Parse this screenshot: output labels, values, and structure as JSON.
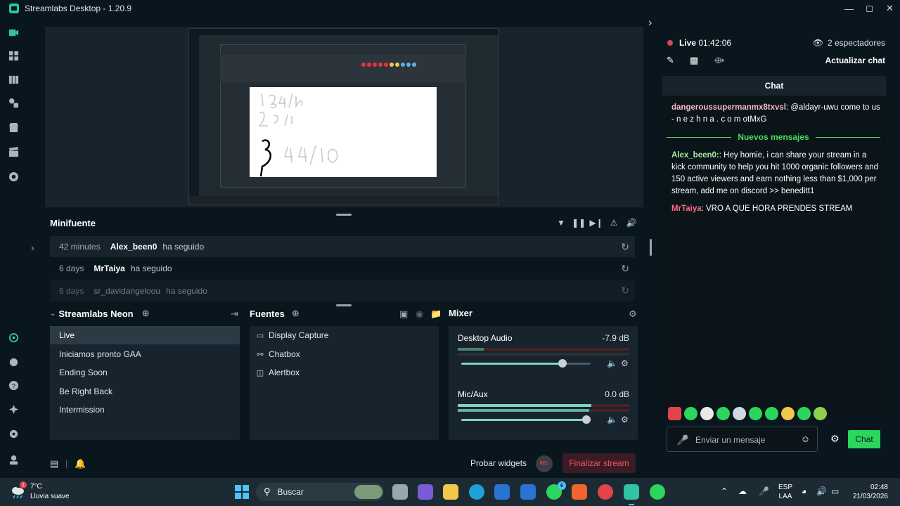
{
  "window": {
    "title": "Streamlabs Desktop - 1.20.9"
  },
  "minifuente": {
    "title": "Minifuente",
    "rows": [
      {
        "time": "42 minutes",
        "user": "Alex_been0",
        "action": "ha seguido"
      },
      {
        "time": "6 days",
        "user": "MrTaiya",
        "action": "ha seguido"
      },
      {
        "time": "6 days",
        "user": "sr_davidangeloou",
        "action": "ha seguido"
      }
    ]
  },
  "scenes": {
    "collection": "Streamlabs Neon",
    "items": [
      "Live",
      "Iniciamos pronto GAA",
      "Ending Soon",
      "Be Right Back",
      "Intermission"
    ],
    "active_index": 0
  },
  "sources": {
    "title": "Fuentes",
    "items": [
      {
        "label": "Display Capture",
        "icon": "monitor-icon"
      },
      {
        "label": "Chatbox",
        "icon": "chat-bubbles-icon"
      },
      {
        "label": "Alertbox",
        "icon": "alertbox-icon"
      }
    ]
  },
  "mixer": {
    "title": "Mixer",
    "channels": [
      {
        "name": "Desktop Audio",
        "db": "-7.9 dB",
        "level": 0.78,
        "meter": 0.15
      },
      {
        "name": "Mic/Aux",
        "db": "0.0 dB",
        "level": 1.0,
        "meter": 0.78
      }
    ]
  },
  "footer": {
    "test_widgets": "Probar widgets",
    "rec_label": "REC",
    "finish_stream": "Finalizar stream"
  },
  "chat_panel": {
    "live_label": "Live",
    "live_time": "01:42:06",
    "viewers": "2 espectadores",
    "update_chat": "Actualizar chat",
    "chat_title": "Chat",
    "messages": [
      {
        "user": "dangeroussupermanmx8txvsl",
        "user_color": "#f3b9c8",
        "text": " @aldayr-uwu come to us - n e z h n a . c o m otMxG"
      },
      {
        "user": "Alex_been0:",
        "user_color": "#a6e99b",
        "text": " Hey homie, i can share your stream in a kick community to help you hit 1000 organic followers and 150 active viewers and earn nothing less than $1,000 per stream, add me on discord >> beneditt1"
      },
      {
        "user": "MrTaiya",
        "user_color": "#ff6a8a",
        "text": " VRO A QUE HORA PRENDES STREAM"
      }
    ],
    "new_messages_label": "Nuevos mensajes",
    "input_placeholder": "Enviar un mensaje",
    "send_label": "Chat"
  },
  "taskbar": {
    "weather_temp": "7°C",
    "weather_desc": "Lluvia suave",
    "weather_badge": "1",
    "search_label": "Buscar",
    "whatsapp_badge": "6",
    "lang_top": "ESP",
    "lang_bottom": "LAA",
    "time": "02:48",
    "date": "21/03/2026"
  },
  "colors": {
    "accent": "#31c3a2",
    "live_red": "#e2444b",
    "chat_green": "#2bd65d",
    "new_messages_green": "#4bdc5a"
  }
}
